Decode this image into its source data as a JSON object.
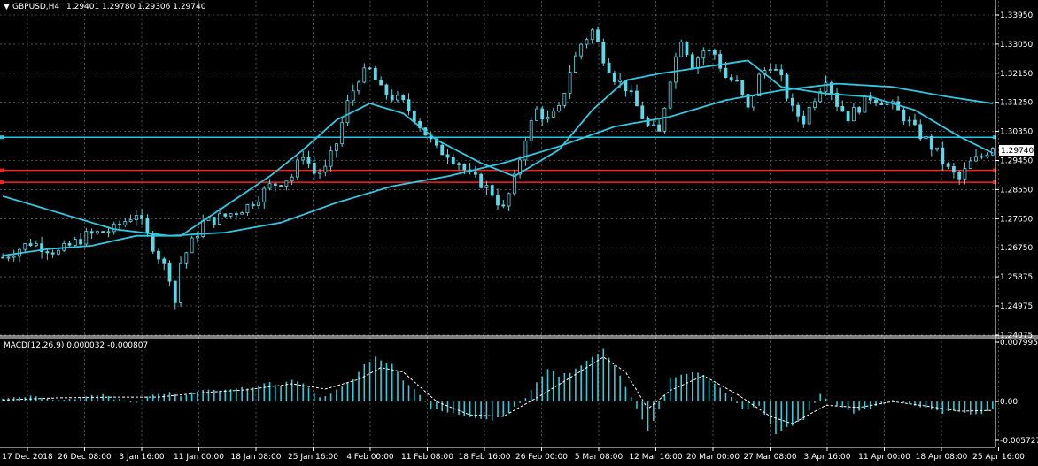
{
  "header": {
    "symbol": "GBPUSD,H4",
    "ohlc": "1.29401 1.29780 1.29306 1.29740"
  },
  "macd_header": "MACD(12,26,9) 0.000032 -0.000807",
  "current_price_label": "1.29740",
  "colors": {
    "background": "#000000",
    "grid": "#7f8590",
    "candles": "#5ed7e6",
    "moving_averages": "#33c8e0",
    "support_line": "#ff1f1f",
    "resistance_line": "#22c8e0",
    "macd_histogram": "#38c9d6",
    "macd_signal": "#ffffff",
    "axis_text": "#ffffff"
  },
  "chart_data": [
    {
      "type": "candlestick",
      "title": "GBPUSD,H4",
      "price_axis_ticks": [
        "1.33950",
        "1.33050",
        "1.32150",
        "1.31250",
        "1.30350",
        "1.29450",
        "1.28550",
        "1.27650",
        "1.26750",
        "1.25875",
        "1.24975",
        "1.24075"
      ],
      "ylim": [
        1.24,
        1.341
      ],
      "time_axis_labels": [
        "17 Dec 2018",
        "26 Dec 08:00",
        "3 Jan 16:00",
        "11 Jan 00:00",
        "18 Jan 08:00",
        "25 Jan 16:00",
        "4 Feb 00:00",
        "11 Feb 08:00",
        "18 Feb 16:00",
        "26 Feb 00:00",
        "5 Mar 08:00",
        "12 Mar 16:00",
        "20 Mar 00:00",
        "27 Mar 08:00",
        "3 Apr 16:00",
        "11 Apr 00:00",
        "18 Apr 08:00",
        "25 Apr 16:00"
      ],
      "grid": true,
      "last_close": 1.2974,
      "horizontal_lines": [
        {
          "price": 1.2998,
          "style": "resistance"
        },
        {
          "price": 1.2898,
          "style": "support"
        },
        {
          "price": 1.2862,
          "style": "support"
        }
      ],
      "price_path": [
        [
          0,
          1.2635
        ],
        [
          5,
          1.268
        ],
        [
          10,
          1.265
        ],
        [
          15,
          1.27
        ],
        [
          20,
          1.272
        ],
        [
          24,
          1.277
        ],
        [
          26,
          1.27
        ],
        [
          30,
          1.258
        ],
        [
          31,
          1.25
        ],
        [
          32,
          1.262
        ],
        [
          34,
          1.268
        ],
        [
          36,
          1.274
        ],
        [
          40,
          1.276
        ],
        [
          44,
          1.279
        ],
        [
          48,
          1.285
        ],
        [
          52,
          1.288
        ],
        [
          54,
          1.295
        ],
        [
          56,
          1.289
        ],
        [
          58,
          1.29
        ],
        [
          60,
          1.298
        ],
        [
          62,
          1.31
        ],
        [
          64,
          1.318
        ],
        [
          66,
          1.32
        ],
        [
          68,
          1.314
        ],
        [
          70,
          1.312
        ],
        [
          72,
          1.31
        ],
        [
          74,
          1.306
        ],
        [
          76,
          1.301
        ],
        [
          78,
          1.296
        ],
        [
          80,
          1.295
        ],
        [
          82,
          1.292
        ],
        [
          84,
          1.288
        ],
        [
          86,
          1.286
        ],
        [
          88,
          1.283
        ],
        [
          90,
          1.278
        ],
        [
          92,
          1.287
        ],
        [
          94,
          1.3
        ],
        [
          96,
          1.308
        ],
        [
          98,
          1.305
        ],
        [
          100,
          1.308
        ],
        [
          102,
          1.32
        ],
        [
          104,
          1.328
        ],
        [
          106,
          1.332
        ],
        [
          108,
          1.324
        ],
        [
          110,
          1.318
        ],
        [
          112,
          1.315
        ],
        [
          114,
          1.309
        ],
        [
          116,
          1.303
        ],
        [
          118,
          1.301
        ],
        [
          120,
          1.318
        ],
        [
          122,
          1.33
        ],
        [
          124,
          1.322
        ],
        [
          126,
          1.326
        ],
        [
          128,
          1.325
        ],
        [
          130,
          1.318
        ],
        [
          132,
          1.316
        ],
        [
          134,
          1.308
        ],
        [
          136,
          1.318
        ],
        [
          138,
          1.322
        ],
        [
          140,
          1.317
        ],
        [
          142,
          1.308
        ],
        [
          144,
          1.305
        ],
        [
          146,
          1.312
        ],
        [
          148,
          1.318
        ],
        [
          150,
          1.31
        ],
        [
          152,
          1.306
        ],
        [
          154,
          1.309
        ],
        [
          156,
          1.312
        ],
        [
          158,
          1.311
        ],
        [
          160,
          1.309
        ],
        [
          162,
          1.306
        ],
        [
          164,
          1.302
        ],
        [
          166,
          1.299
        ],
        [
          168,
          1.295
        ],
        [
          170,
          1.29
        ],
        [
          172,
          1.287
        ],
        [
          174,
          1.292
        ],
        [
          176,
          1.294
        ],
        [
          178,
          1.2974
        ]
      ],
      "series": [
        {
          "role": "fast_ma",
          "values": [
            [
              0,
              1.264
            ],
            [
              8,
              1.266
            ],
            [
              16,
              1.267
            ],
            [
              24,
              1.27
            ],
            [
              32,
              1.27
            ],
            [
              40,
              1.279
            ],
            [
              48,
              1.288
            ],
            [
              54,
              1.296
            ],
            [
              60,
              1.305
            ],
            [
              66,
              1.31
            ],
            [
              72,
              1.307
            ],
            [
              78,
              1.299
            ],
            [
              86,
              1.292
            ],
            [
              92,
              1.288
            ],
            [
              100,
              1.296
            ],
            [
              106,
              1.308
            ],
            [
              112,
              1.317
            ],
            [
              118,
              1.319
            ],
            [
              126,
              1.321
            ],
            [
              134,
              1.323
            ],
            [
              140,
              1.315
            ],
            [
              148,
              1.313
            ],
            [
              156,
              1.312
            ],
            [
              164,
              1.308
            ],
            [
              172,
              1.3
            ],
            [
              178,
              1.295
            ]
          ]
        },
        {
          "role": "slow_ma",
          "values": [
            [
              0,
              1.282
            ],
            [
              10,
              1.277
            ],
            [
              20,
              1.272
            ],
            [
              30,
              1.27
            ],
            [
              40,
              1.271
            ],
            [
              50,
              1.274
            ],
            [
              60,
              1.28
            ],
            [
              70,
              1.285
            ],
            [
              80,
              1.288
            ],
            [
              90,
              1.292
            ],
            [
              100,
              1.297
            ],
            [
              110,
              1.303
            ],
            [
              120,
              1.306
            ],
            [
              130,
              1.311
            ],
            [
              140,
              1.314
            ],
            [
              150,
              1.316
            ],
            [
              160,
              1.315
            ],
            [
              170,
              1.312
            ],
            [
              178,
              1.31
            ]
          ]
        }
      ]
    },
    {
      "type": "bar",
      "title": "MACD(12,26,9) 0.000032 -0.000807",
      "value_axis_ticks": [
        "0.007995",
        "0.00",
        "-0.005727"
      ],
      "ylim": [
        -0.0062,
        0.0085
      ],
      "histogram_path": [
        [
          0,
          0.0005
        ],
        [
          6,
          0.0008
        ],
        [
          10,
          0.0002
        ],
        [
          15,
          0.0006
        ],
        [
          18,
          0.001
        ],
        [
          20,
          0.0004
        ],
        [
          24,
          -0.0002
        ],
        [
          26,
          0.0008
        ],
        [
          28,
          0.001
        ],
        [
          30,
          0.0012
        ],
        [
          32,
          0.0006
        ],
        [
          34,
          0.0012
        ],
        [
          36,
          0.0015
        ],
        [
          40,
          0.0015
        ],
        [
          45,
          0.002
        ],
        [
          48,
          0.0025
        ],
        [
          50,
          0.0022
        ],
        [
          52,
          0.003
        ],
        [
          55,
          0.002
        ],
        [
          57,
          0.0005
        ],
        [
          60,
          0.0015
        ],
        [
          63,
          0.003
        ],
        [
          65,
          0.005
        ],
        [
          67,
          0.006
        ],
        [
          70,
          0.005
        ],
        [
          72,
          0.003
        ],
        [
          75,
          0.001
        ],
        [
          77,
          -0.001
        ],
        [
          80,
          -0.0015
        ],
        [
          84,
          -0.002
        ],
        [
          88,
          -0.0025
        ],
        [
          91,
          -0.0015
        ],
        [
          94,
          0.0005
        ],
        [
          96,
          0.0025
        ],
        [
          98,
          0.0045
        ],
        [
          100,
          0.0035
        ],
        [
          102,
          0.004
        ],
        [
          105,
          0.0055
        ],
        [
          108,
          0.007
        ],
        [
          110,
          0.005
        ],
        [
          112,
          0.002
        ],
        [
          114,
          -0.001
        ],
        [
          116,
          -0.004
        ],
        [
          118,
          -0.001
        ],
        [
          120,
          0.003
        ],
        [
          122,
          0.0035
        ],
        [
          125,
          0.004
        ],
        [
          128,
          0.0025
        ],
        [
          131,
          0.0005
        ],
        [
          133,
          -0.001
        ],
        [
          136,
          -0.0005
        ],
        [
          139,
          -0.0045
        ],
        [
          141,
          -0.0035
        ],
        [
          144,
          -0.0025
        ],
        [
          147,
          0.001
        ],
        [
          150,
          -0.0005
        ],
        [
          153,
          -0.0015
        ],
        [
          156,
          -0.001
        ],
        [
          160,
          0.0003
        ],
        [
          163,
          -0.0003
        ],
        [
          166,
          -0.001
        ],
        [
          169,
          -0.0015
        ],
        [
          172,
          -0.0012
        ],
        [
          175,
          -0.0018
        ],
        [
          178,
          -0.001
        ]
      ],
      "signal_path": [
        [
          0,
          0.0002
        ],
        [
          10,
          0.0005
        ],
        [
          20,
          0.0006
        ],
        [
          28,
          0.0006
        ],
        [
          36,
          0.0012
        ],
        [
          44,
          0.0016
        ],
        [
          52,
          0.0024
        ],
        [
          58,
          0.0017
        ],
        [
          64,
          0.003
        ],
        [
          68,
          0.0046
        ],
        [
          72,
          0.004
        ],
        [
          78,
          0.0
        ],
        [
          84,
          -0.0018
        ],
        [
          90,
          -0.002
        ],
        [
          96,
          0.0005
        ],
        [
          102,
          0.0032
        ],
        [
          108,
          0.006
        ],
        [
          112,
          0.004
        ],
        [
          116,
          -0.001
        ],
        [
          120,
          0.0015
        ],
        [
          126,
          0.0035
        ],
        [
          132,
          0.001
        ],
        [
          138,
          -0.002
        ],
        [
          142,
          -0.003
        ],
        [
          148,
          -0.0005
        ],
        [
          154,
          -0.0008
        ],
        [
          160,
          0.0
        ],
        [
          166,
          -0.0006
        ],
        [
          172,
          -0.0013
        ],
        [
          178,
          -0.0012
        ]
      ]
    }
  ]
}
